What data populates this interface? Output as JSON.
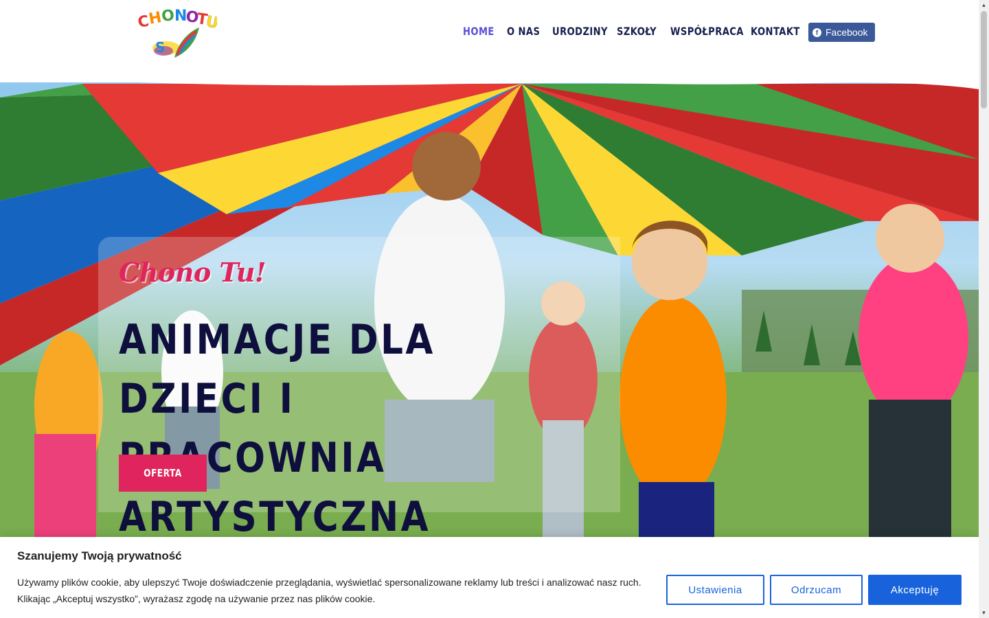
{
  "logo": {
    "text": "CHONO TU",
    "letter_colors": [
      "#e53935",
      "#fb8c00",
      "#43a047",
      "#1e88e5",
      "#8e24aa",
      "#e53935",
      "#fdd835",
      "#1e88e5"
    ]
  },
  "nav": {
    "items": [
      {
        "label": "HOME",
        "active": true
      },
      {
        "label": "O NAS",
        "active": false
      },
      {
        "label": "URODZINY",
        "active": false
      },
      {
        "label": "SZKOŁY",
        "active": false
      },
      {
        "label": "WSPÓŁPRACA",
        "active": false
      },
      {
        "label": "KONTAKT",
        "active": false
      }
    ],
    "facebook_label": "Facebook"
  },
  "hero": {
    "tagline": "Chono Tu!",
    "title_line1": "ANIMACJE DLA DZIECI I",
    "title_line2": "PRACOWNIA ARTYSTYCZNA",
    "button_label": "OFERTA"
  },
  "cookie": {
    "title": "Szanujemy Twoją prywatność",
    "text": "Używamy plików cookie, aby ulepszyć Twoje doświadczenie przeglądania, wyświetlać spersonalizowane reklamy lub treści i analizować nasz ruch. Klikając „Akceptuj wszystko”, wyrażasz zgodę na używanie przez nas plików cookie.",
    "settings_label": "Ustawienia",
    "reject_label": "Odrzucam",
    "accept_label": "Akceptuję"
  },
  "colors": {
    "nav_text": "#17204f",
    "nav_active": "#5a4fd6",
    "facebook": "#3b5998",
    "accent": "#e0245e",
    "hero_title": "#0e0f3c",
    "cookie_blue": "#1863dc"
  },
  "icons": {
    "facebook": "facebook-icon",
    "scroll_up": "scroll-up-arrow-icon",
    "scroll_down": "scroll-down-arrow-icon"
  }
}
